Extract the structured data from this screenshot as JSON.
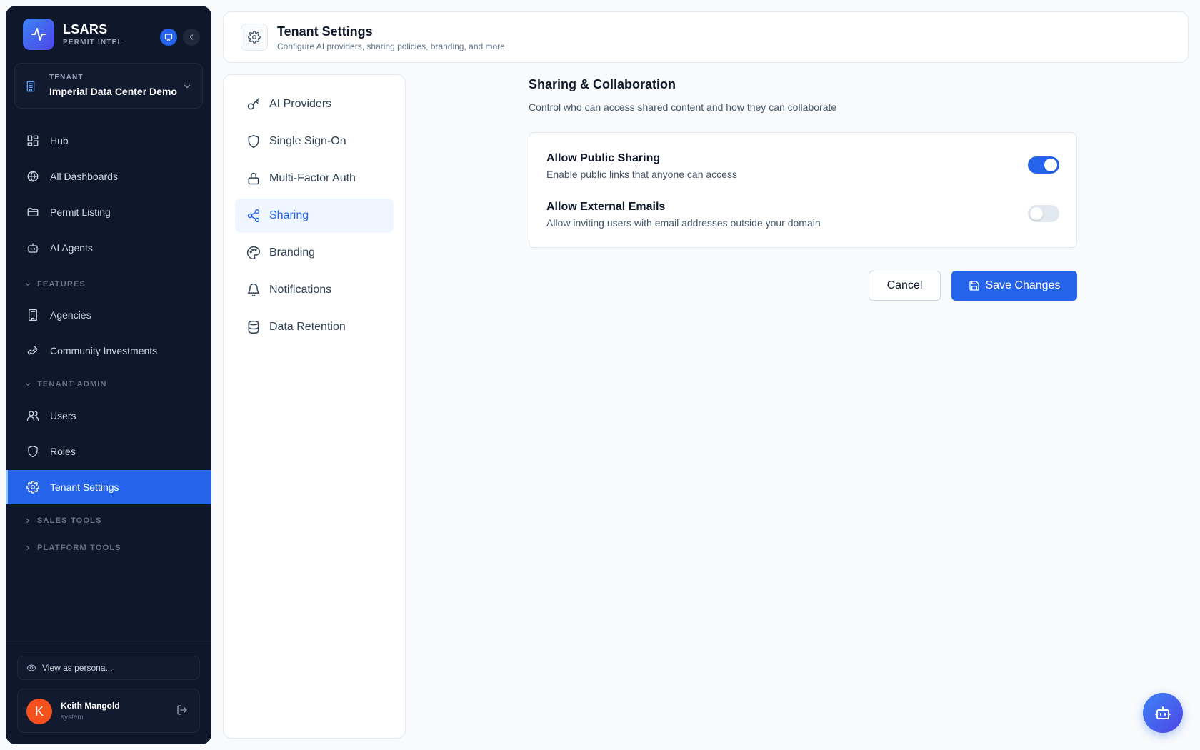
{
  "brand": {
    "name": "LSARS",
    "subtitle": "PERMIT INTEL"
  },
  "tenant": {
    "label": "TENANT",
    "name": "Imperial Data Center Demo"
  },
  "sidebar": {
    "items": [
      {
        "label": "Hub",
        "icon": "grid-icon"
      },
      {
        "label": "All Dashboards",
        "icon": "globe-icon"
      },
      {
        "label": "Permit Listing",
        "icon": "folder-icon"
      },
      {
        "label": "AI Agents",
        "icon": "bot-icon"
      }
    ],
    "features": {
      "label": "FEATURES",
      "items": [
        {
          "label": "Agencies",
          "icon": "building-icon"
        },
        {
          "label": "Community Investments",
          "icon": "hand-coins-icon"
        }
      ]
    },
    "tenant_admin": {
      "label": "TENANT ADMIN",
      "items": [
        {
          "label": "Users",
          "icon": "users-icon"
        },
        {
          "label": "Roles",
          "icon": "shield-icon"
        },
        {
          "label": "Tenant Settings",
          "icon": "gear-icon",
          "active": true
        }
      ]
    },
    "sales_tools": {
      "label": "SALES TOOLS"
    },
    "platform_tools": {
      "label": "PLATFORM TOOLS"
    },
    "persona": {
      "label": "View as persona..."
    },
    "user": {
      "initial": "K",
      "name": "Keith Mangold",
      "role": "system"
    }
  },
  "header": {
    "title": "Tenant Settings",
    "subtitle": "Configure AI providers, sharing policies, branding, and more"
  },
  "settings_nav": {
    "items": [
      {
        "label": "AI Providers",
        "icon": "key-icon"
      },
      {
        "label": "Single Sign-On",
        "icon": "shield-icon"
      },
      {
        "label": "Multi-Factor Auth",
        "icon": "lock-icon"
      },
      {
        "label": "Sharing",
        "icon": "share-icon",
        "active": true
      },
      {
        "label": "Branding",
        "icon": "palette-icon"
      },
      {
        "label": "Notifications",
        "icon": "bell-icon"
      },
      {
        "label": "Data Retention",
        "icon": "database-icon"
      }
    ]
  },
  "main": {
    "title": "Sharing & Collaboration",
    "subtitle": "Control who can access shared content and how they can collaborate",
    "options": [
      {
        "title": "Allow Public Sharing",
        "description": "Enable public links that anyone can access",
        "enabled": true
      },
      {
        "title": "Allow External Emails",
        "description": "Allow inviting users with email addresses outside your domain",
        "enabled": false
      }
    ],
    "cancel_label": "Cancel",
    "save_label": "Save Changes"
  },
  "colors": {
    "sidebar_bg": "#0f172a",
    "accent": "#2563eb",
    "active_nav_bg": "#eff6ff",
    "avatar": "#f4511e"
  }
}
